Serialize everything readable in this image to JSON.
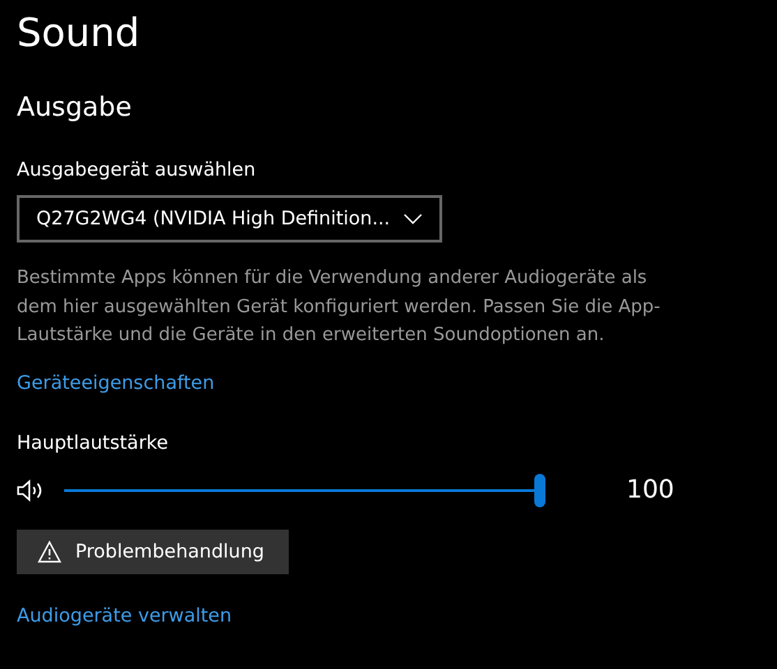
{
  "page_title": "Sound",
  "section_title": "Ausgabe",
  "output_device": {
    "label": "Ausgabegerät auswählen",
    "value": "Q27G2WG4 (NVIDIA High Definition..."
  },
  "description": "Bestimmte Apps können für die Verwendung anderer Audiogeräte als dem hier ausgewählten Gerät konfiguriert werden. Passen Sie die App-Lautstärke und die Geräte in den erweiterten Soundoptionen an.",
  "device_properties_link": "Geräteeigenschaften",
  "master_volume": {
    "label": "Hauptlautstärke",
    "level": 1.0,
    "reading": "100"
  },
  "troubleshoot_button": "Problembehandlung",
  "manage_devices_link": "Audiogeräte verwalten"
}
